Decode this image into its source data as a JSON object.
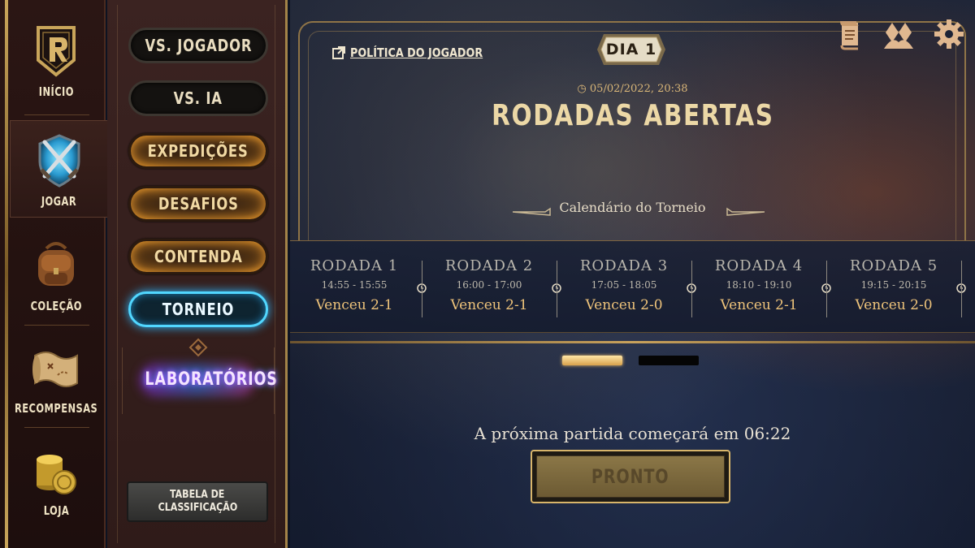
{
  "nav": {
    "items": [
      {
        "label": "INÍCIO",
        "icon": "runeterra-r-icon"
      },
      {
        "label": "JOGAR",
        "icon": "crossed-swords-shield-icon"
      },
      {
        "label": "COLEÇÃO",
        "icon": "backpack-icon"
      },
      {
        "label": "RECOMPENSAS",
        "icon": "treasure-map-icon"
      },
      {
        "label": "LOJA",
        "icon": "coins-icon"
      }
    ],
    "active": "JOGAR"
  },
  "modes": {
    "vs_player": "VS. JOGADOR",
    "vs_ai": "VS. IA",
    "expeditions": "EXPEDIÇÕES",
    "challenges": "DESAFIOS",
    "contend": "CONTENDA",
    "tournament": "TORNEIO",
    "labs": "LABORATÓRIOS",
    "standings_line1": "TABELA DE",
    "standings_line2": "CLASSIFICAÇÃO"
  },
  "header": {
    "policy_label": "POLÍTICA DO JOGADOR",
    "day_label": "DIA 1",
    "icons": [
      "scroll-icon",
      "social-icon",
      "gear-icon"
    ]
  },
  "phase": {
    "datetime": "05/02/2022, 20:38",
    "title": "RODADAS ABERTAS",
    "calendar_label": "Calendário do Torneio"
  },
  "rounds": [
    {
      "name": "RODADA 1",
      "time": "14:55 - 15:55",
      "result": "Venceu 2-1"
    },
    {
      "name": "RODADA 2",
      "time": "16:00 - 17:00",
      "result": "Venceu 2-1"
    },
    {
      "name": "RODADA 3",
      "time": "17:05 - 18:05",
      "result": "Venceu 2-0"
    },
    {
      "name": "RODADA 4",
      "time": "18:10 - 19:10",
      "result": "Venceu 2-1"
    },
    {
      "name": "RODADA 5",
      "time": "19:15 - 20:15",
      "result": "Venceu 2-0"
    }
  ],
  "footer": {
    "next_match": "A próxima partida começará em 06:22",
    "ready_label": "PRONTO"
  },
  "colors": {
    "gold": "#c9a25c",
    "result_gold": "#eec37a",
    "tournament_blue": "#51d7ff"
  }
}
